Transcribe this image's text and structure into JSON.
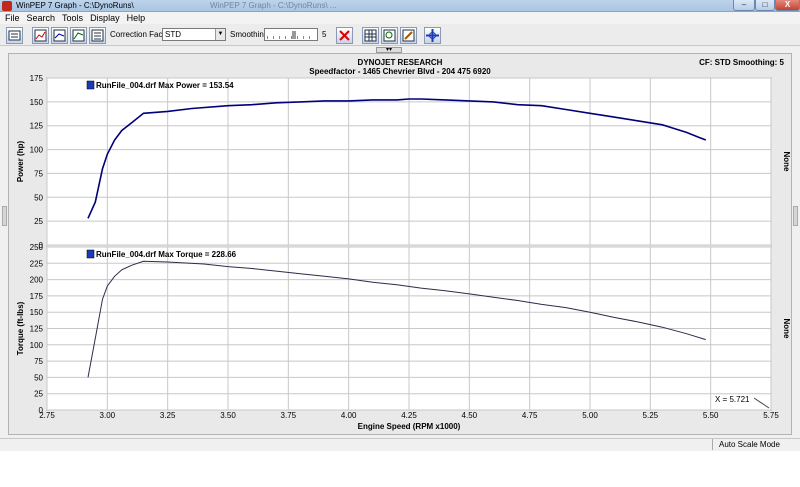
{
  "window": {
    "title": "WinPEP 7   Graph - C:\\DynoRuns\\",
    "ghost_title": "WinPEP 7   Graph - C:\\DynoRuns\\  ...",
    "minimize": "–",
    "maximize": "□",
    "close": "X"
  },
  "menu": [
    "File",
    "Search",
    "Tools",
    "Display",
    "Help"
  ],
  "toolbar": {
    "correction_label": "Correction Factor:",
    "correction_value": "STD",
    "smoothing_label": "Smoothing:",
    "smoothing_value": "5",
    "buttons": [
      "open-icon",
      "graph-icon",
      "graph-edit-icon",
      "graph-compare-icon",
      "graph-list-icon",
      "cancel-icon",
      "grid-icon",
      "zoom-icon",
      "edit-icon",
      "crosshair-icon"
    ]
  },
  "header": {
    "line1": "DYNOJET RESEARCH",
    "line2": "Speedfactor - 1465 Chevrier Blvd - 204 475 6920",
    "right": "CF: STD  Smoothing: 5"
  },
  "status": {
    "scale_mode": "Auto Scale Mode"
  },
  "colors": {
    "power": "#00007a",
    "torque": "#2c2c4a",
    "legend_swatch": "#1a3ab8",
    "grid": "#c8c8c8"
  },
  "chart_data": [
    {
      "type": "line",
      "title": "",
      "ylabel": "Power (hp)",
      "right_label": "None",
      "ylim": [
        0,
        175
      ],
      "yticks": [
        "0",
        "25",
        "50",
        "75",
        "100",
        "125",
        "150",
        "175"
      ],
      "series": [
        {
          "name": "RunFile_004.drf Max Power = 153.54",
          "x": [
            2.92,
            2.95,
            2.98,
            3.0,
            3.03,
            3.06,
            3.1,
            3.15,
            3.25,
            3.35,
            3.5,
            3.6,
            3.7,
            3.8,
            3.9,
            4.0,
            4.1,
            4.2,
            4.25,
            4.3,
            4.4,
            4.5,
            4.6,
            4.7,
            4.8,
            4.9,
            5.0,
            5.1,
            5.2,
            5.3,
            5.35,
            5.4,
            5.45,
            5.48
          ],
          "y": [
            28,
            45,
            80,
            95,
            110,
            120,
            128,
            138,
            140,
            143,
            146,
            147,
            149,
            150,
            151,
            151,
            152,
            152,
            153,
            153,
            152,
            151,
            150,
            147,
            146,
            142,
            138,
            134,
            130,
            126,
            122,
            118,
            113,
            110
          ]
        }
      ]
    },
    {
      "type": "line",
      "title": "",
      "ylabel": "Torque (ft-lbs)",
      "xlabel": "Engine Speed (RPM x1000)",
      "right_label": "None",
      "ylim": [
        0,
        250
      ],
      "xlim": [
        2.75,
        5.75
      ],
      "yticks": [
        "0",
        "25",
        "50",
        "75",
        "100",
        "125",
        "150",
        "175",
        "200",
        "225",
        "250"
      ],
      "xticks": [
        "2.75",
        "3.00",
        "3.25",
        "3.50",
        "3.75",
        "4.00",
        "4.25",
        "4.50",
        "4.75",
        "5.00",
        "5.25",
        "5.50",
        "5.75"
      ],
      "cursor": "X = 5.721",
      "series": [
        {
          "name": "RunFile_004.drf Max Torque = 228.66",
          "x": [
            2.92,
            2.95,
            2.98,
            3.0,
            3.03,
            3.06,
            3.1,
            3.15,
            3.25,
            3.4,
            3.5,
            3.6,
            3.7,
            3.8,
            3.9,
            4.0,
            4.1,
            4.2,
            4.3,
            4.4,
            4.5,
            4.6,
            4.7,
            4.8,
            4.9,
            5.0,
            5.1,
            5.2,
            5.3,
            5.4,
            5.48
          ],
          "y": [
            50,
            110,
            170,
            190,
            205,
            215,
            222,
            228,
            227,
            224,
            220,
            217,
            213,
            209,
            205,
            201,
            196,
            192,
            187,
            183,
            178,
            173,
            168,
            162,
            157,
            150,
            142,
            135,
            127,
            117,
            108
          ]
        }
      ]
    }
  ]
}
